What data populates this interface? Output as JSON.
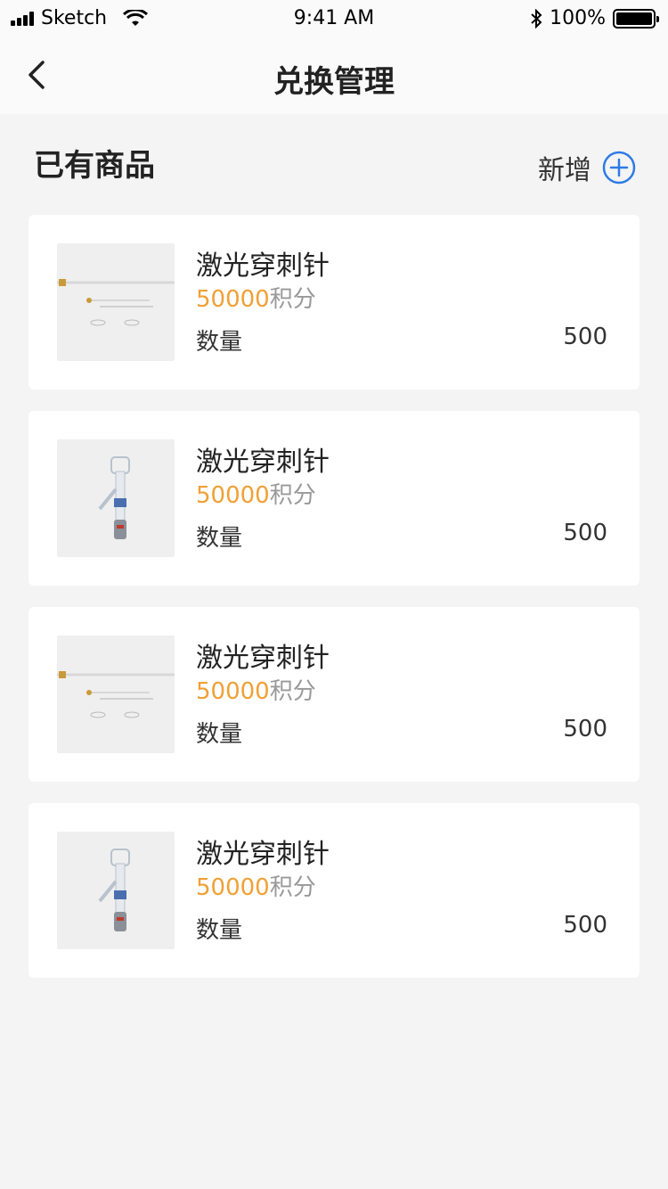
{
  "status_bar": {
    "carrier": "Sketch",
    "time": "9:41 AM",
    "battery": "100%"
  },
  "nav": {
    "title": "兑换管理",
    "back_icon": "chevron-left-icon"
  },
  "section": {
    "title": "已有商品",
    "add_label": "新增",
    "add_icon": "plus-circle-icon"
  },
  "colors": {
    "accent": "#2e7be5",
    "points": "#f0a035",
    "background": "#f4f4f4"
  },
  "products": [
    {
      "name": "激光穿刺针",
      "points": "50000",
      "points_unit": "积分",
      "qty_label": "数量",
      "qty": "500",
      "image": "needle-kit-image"
    },
    {
      "name": "激光穿刺针",
      "points": "50000",
      "points_unit": "积分",
      "qty_label": "数量",
      "qty": "500",
      "image": "y-connector-image"
    },
    {
      "name": "激光穿刺针",
      "points": "50000",
      "points_unit": "积分",
      "qty_label": "数量",
      "qty": "500",
      "image": "needle-kit-image"
    },
    {
      "name": "激光穿刺针",
      "points": "50000",
      "points_unit": "积分",
      "qty_label": "数量",
      "qty": "500",
      "image": "y-connector-image"
    }
  ]
}
